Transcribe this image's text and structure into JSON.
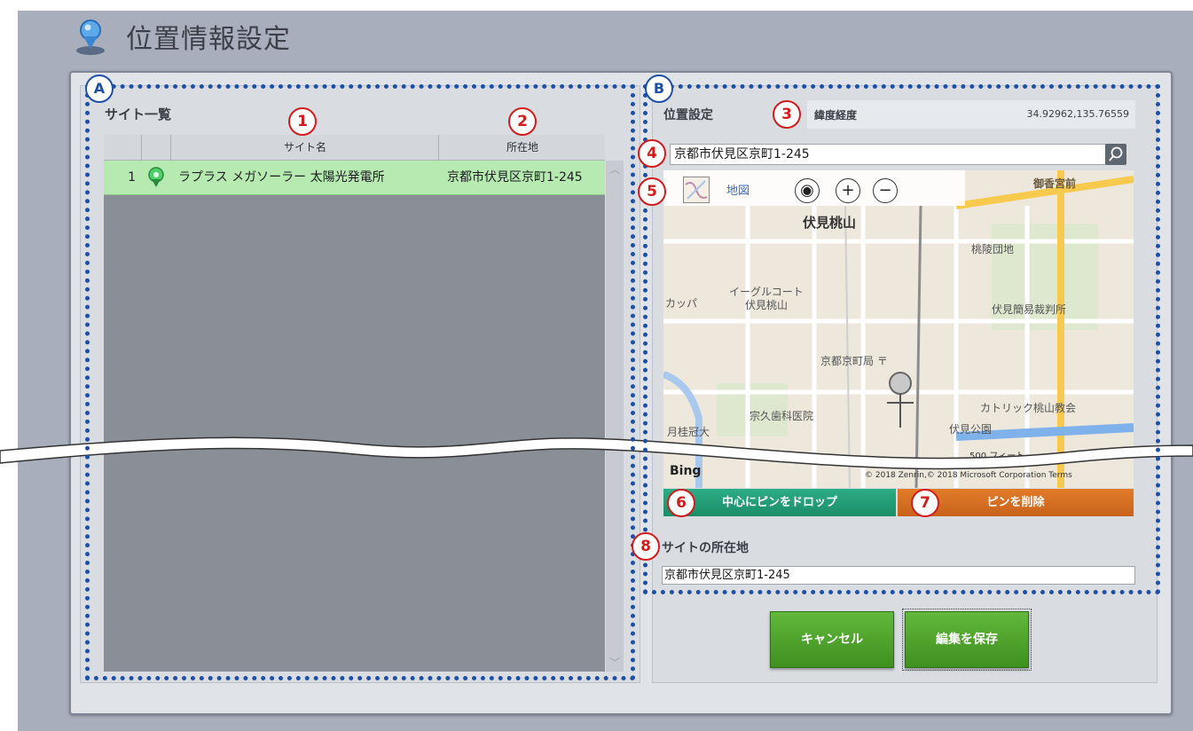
{
  "window": {
    "title": "位置情報設定"
  },
  "region_markers": {
    "a": "A",
    "b": "B"
  },
  "site_list": {
    "heading": "サイト一覧",
    "columns": [
      "サイト名",
      "所在地"
    ],
    "rows": [
      {
        "index": "1",
        "name": "ラプラス メガソーラー 太陽光発電所",
        "address": "京都市伏見区京町1-245"
      }
    ]
  },
  "location": {
    "heading": "位置設定",
    "latlng_label": "緯度経度",
    "latlng_value": "34.92962,135.76559",
    "search_value": "京都市伏見区京町1-245",
    "map_type_label": "地図",
    "map_labels": {
      "l1": "御香宮前",
      "l2": "伏見桃山",
      "l3": "桃陵団地",
      "l4": "イーグルコート",
      "l5": "伏見桃山",
      "l6": "カッパ",
      "l7": "伏見簡易裁判所",
      "l8": "京都京町局 〒",
      "l9": "宗久歯科医院",
      "l10": "カトリック桃山教会",
      "l11": "月桂冠大",
      "l12": "伏見公園"
    },
    "bing": "Bing",
    "attribution": "© 2018 Zenrin,© 2018 Microsoft Corporation  Terms",
    "scale": "500 フィート",
    "drop_pin_label": "中心にピンをドロップ",
    "delete_pin_label": "ピンを削除"
  },
  "site_address": {
    "heading": "サイトの所在地",
    "value": "京都市伏見区京町1-245"
  },
  "actions": {
    "cancel_label": "キャンセル",
    "save_label": "編集を保存"
  },
  "callouts": [
    "1",
    "2",
    "3",
    "4",
    "5",
    "6",
    "7",
    "8"
  ],
  "colors": {
    "selected_row": "#b6eab0",
    "drop_pin_button": "#1f9a72",
    "delete_pin_button": "#d46e22",
    "action_button": "#4fa42e",
    "region_outline": "#1e4fa8",
    "callout": "#d31b1b"
  }
}
